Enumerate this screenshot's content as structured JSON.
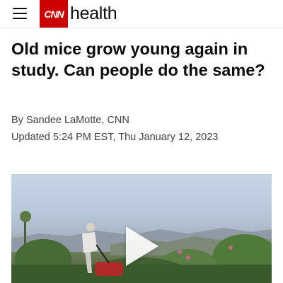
{
  "header": {
    "brand": "CNN",
    "section": "health"
  },
  "article": {
    "headline": "Old mice grow young again in study. Can people do the same?",
    "byline": "By Sandee LaMotte, CNN",
    "updated": "Updated 5:24 PM EST, Thu January 12, 2023"
  },
  "icons": {
    "menu": "hamburger-menu-icon",
    "play": "play-icon"
  },
  "colors": {
    "brand_red": "#cc0000",
    "text": "#0c0c0c",
    "meta_text": "#404040"
  }
}
